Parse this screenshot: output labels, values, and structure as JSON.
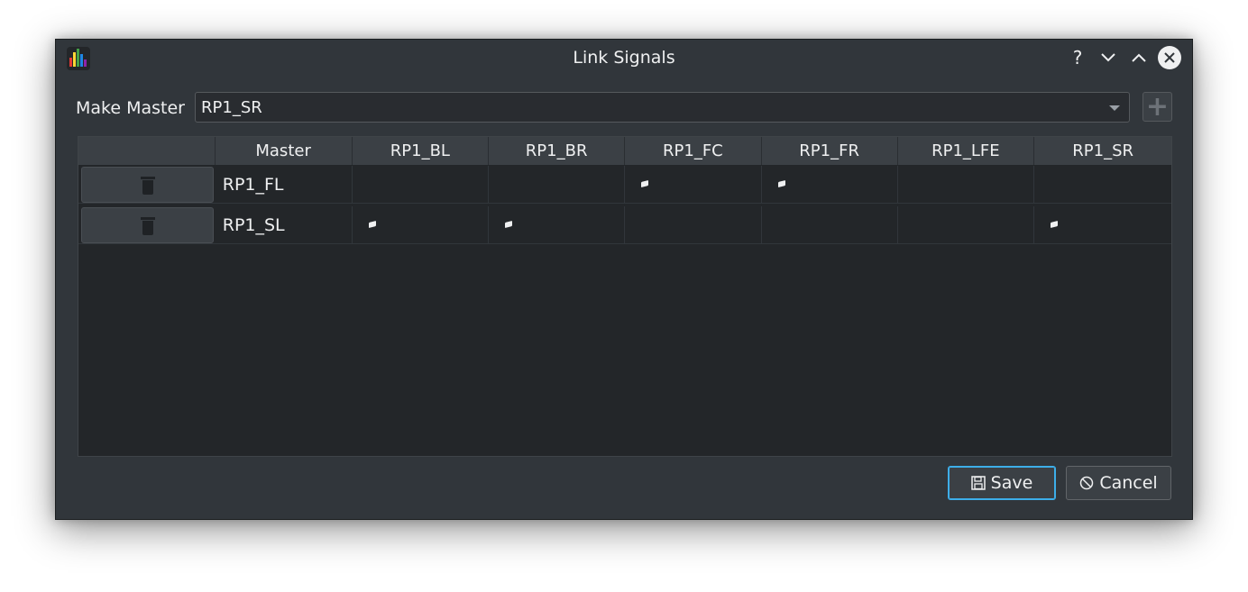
{
  "window": {
    "title": "Link Signals",
    "controls": {
      "help": "?",
      "minimize": "⌄",
      "maximize": "⌃"
    }
  },
  "master": {
    "label": "Make Master",
    "selected": "RP1_SR",
    "add_icon": "+"
  },
  "table": {
    "columns": [
      "",
      "Master",
      "RP1_BL",
      "RP1_BR",
      "RP1_FC",
      "RP1_FR",
      "RP1_LFE",
      "RP1_SR"
    ],
    "rows": [
      {
        "name": "RP1_FL",
        "links": [
          false,
          false,
          true,
          true,
          false,
          false
        ]
      },
      {
        "name": "RP1_SL",
        "links": [
          true,
          true,
          false,
          false,
          false,
          true
        ]
      }
    ]
  },
  "buttons": {
    "save": "Save",
    "cancel": "Cancel"
  },
  "colors": {
    "accent": "#3daee9",
    "window_bg": "#31363b",
    "table_bg": "#232629"
  }
}
